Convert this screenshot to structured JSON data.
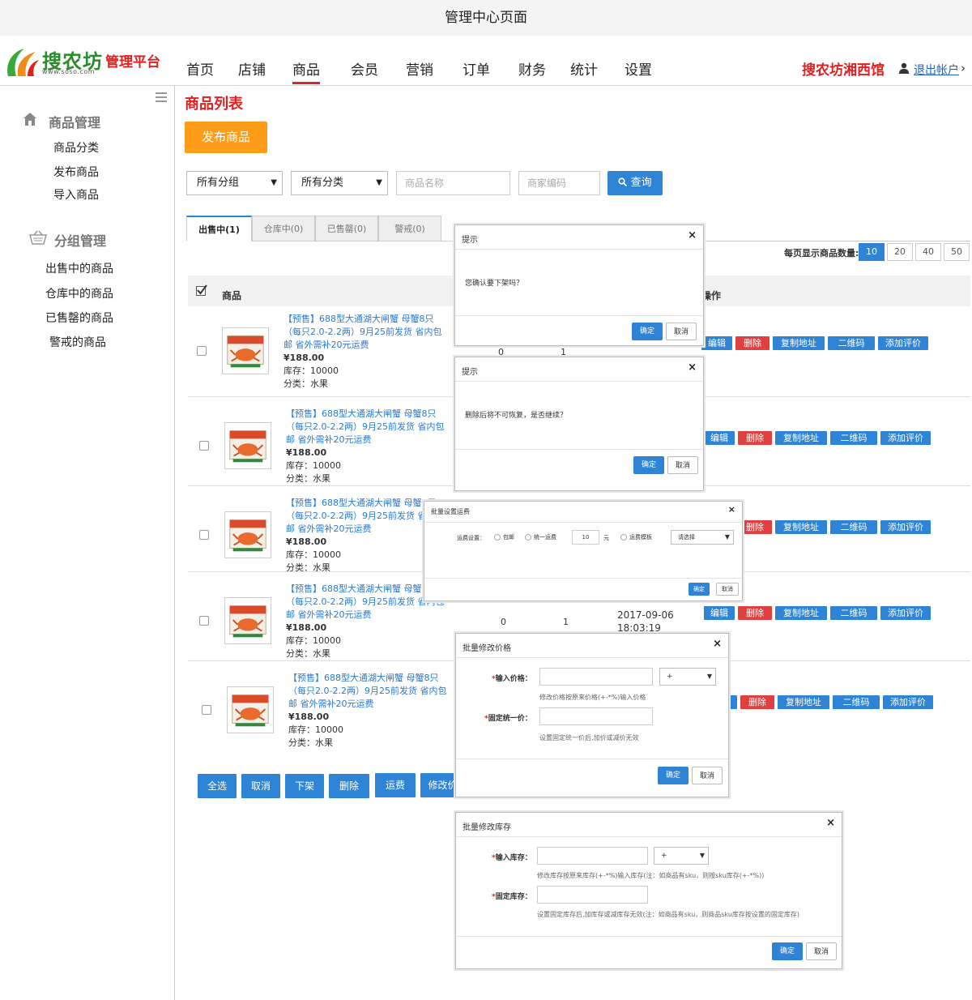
{
  "page": {
    "title": "管理中心页面"
  },
  "brand": {
    "name": "搜农坊",
    "url": "www.soso.com",
    "platform": "管理平台"
  },
  "nav": {
    "items": [
      "首页",
      "店铺",
      "商品",
      "会员",
      "营销",
      "订单",
      "财务",
      "统计",
      "设置"
    ],
    "active": "商品",
    "store_name": "搜农坊湘西馆",
    "logout": "退出帐户",
    "chevron": "›"
  },
  "sidebar": {
    "sections": [
      {
        "title": "商品管理",
        "icon": "home-icon",
        "items": [
          "商品分类",
          "发布商品",
          "导入商品"
        ]
      },
      {
        "title": "分组管理",
        "icon": "basket-icon",
        "items": [
          "出售中的商品",
          "仓库中的商品",
          "已售罄的商品",
          "警戒的商品"
        ]
      }
    ]
  },
  "main": {
    "title": "商品列表",
    "publish_label": "发布商品",
    "filters": {
      "group_select": "所有分组",
      "category_select": "所有分类",
      "name_placeholder": "商品名称",
      "code_placeholder": "商家编码",
      "query_label": "查询",
      "select_arrow": "▼"
    },
    "tabs": [
      "出售中(1)",
      "仓库中(0)",
      "已售罄(0)",
      "警戒(0)"
    ],
    "pager": {
      "label": "每页显示商品数量:",
      "options": [
        "10",
        "20",
        "40",
        "50"
      ],
      "selected": "10"
    },
    "table": {
      "col_goods": "商品",
      "col_op": "操作"
    },
    "product": {
      "title": "【预售】688型大通湖大闸蟹 母蟹8只（每只2.0-2.2两）9月25前发货 省内包邮 省外需补20元运费",
      "price": "¥188.00",
      "stock": "库存：10000",
      "category": "分类：水果"
    },
    "row_values": {
      "c1": "0",
      "c2": "1",
      "date": "2017-09-06",
      "time": "18:03:19"
    },
    "row_ops": [
      "编辑",
      "删除",
      "复制地址",
      "二维码",
      "添加评价"
    ],
    "bulk_actions": [
      "全选",
      "取消",
      "下架",
      "删除",
      "运费",
      "修改价"
    ]
  },
  "dialogs": {
    "confirm_off": {
      "title": "提示",
      "message": "您确认要下架吗？",
      "ok": "确定",
      "cancel": "取消",
      "close": "×"
    },
    "confirm_delete": {
      "title": "提示",
      "message": "删除后将不可恢复，是否继续？",
      "ok": "确定",
      "cancel": "取消",
      "close": "×"
    },
    "freight": {
      "title": "批量设置运费",
      "label": "运费设置：",
      "opt_free": "包邮",
      "opt_fixed": "统一运费",
      "fixed_value": "10",
      "unit": "元",
      "opt_template": "运费模板",
      "template_select": "请选择",
      "ok": "确定",
      "cancel": "取消",
      "close": "×"
    },
    "price": {
      "title": "批量修改价格",
      "input_label": "输入价格：",
      "op_select": "+",
      "hint1": "修改价格按原来价格(+-*%)输入价格",
      "fixed_label": "固定统一价：",
      "hint2": "设置固定统一价后,加价或减价无效",
      "ok": "确定",
      "cancel": "取消",
      "close": "×"
    },
    "stock": {
      "title": "批量修改库存",
      "input_label": "输入库存：",
      "op_select": "+",
      "hint1": "修改库存按原来库存(+-*%)输入库存(注：如商品有sku，则按sku库存(+-*%))",
      "fixed_label": "固定库存：",
      "hint2": "设置固定库存后,加库存或减库存无效(注：如商品有sku，则商品sku库存按设置的固定库存)",
      "ok": "确定",
      "cancel": "取消",
      "close": "×"
    }
  },
  "colors": {
    "accent": "#2f84d6",
    "brand_red": "#e02020",
    "orange": "#ff9c1a",
    "danger": "#e0403f"
  }
}
